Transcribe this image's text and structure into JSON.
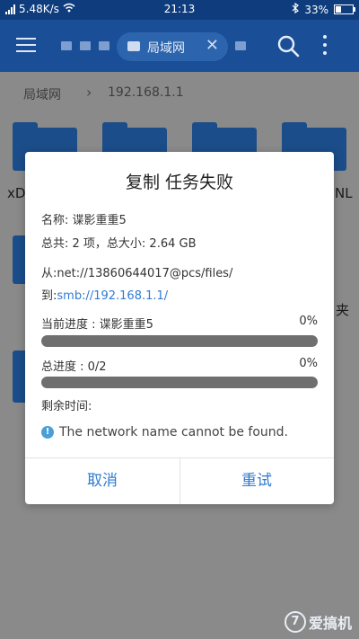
{
  "status_bar": {
    "network_speed": "5.48K/s",
    "time": "21:13",
    "battery": "33%",
    "battery_level": 0.33
  },
  "toolbar": {
    "path_chip_label": "局域网"
  },
  "breadcrumb": {
    "root": "局域网",
    "current": "192.168.1.1"
  },
  "background_fragments": {
    "left_label": "xD",
    "right_label": "NL",
    "right_label_2": "夹"
  },
  "dialog": {
    "title": "复制 任务失败",
    "name_line": "名称: 谍影重重5",
    "total_line": "总共: 2 项，总大小: 2.64 GB",
    "from_line": "从:net://13860644017@pcs/files/",
    "to_prefix": "到:",
    "to_link": "smb://192.168.1.1/",
    "current_progress_label": "当前进度 : 谍影重重5",
    "current_progress_percent": "0%",
    "current_progress_value": 0,
    "total_progress_label": "总进度 : 0/2",
    "total_progress_percent": "0%",
    "total_progress_value": 0,
    "remaining_label": "剩余时间:",
    "error_message": "The network name cannot be found.",
    "cancel_label": "取消",
    "retry_label": "重试"
  },
  "watermark": {
    "brand_mark": "7",
    "text": "爱搞机"
  },
  "colors": {
    "toolbar": "#1a4f97",
    "accent": "#2f7bd0",
    "progress_track": "#6f6f6f"
  }
}
